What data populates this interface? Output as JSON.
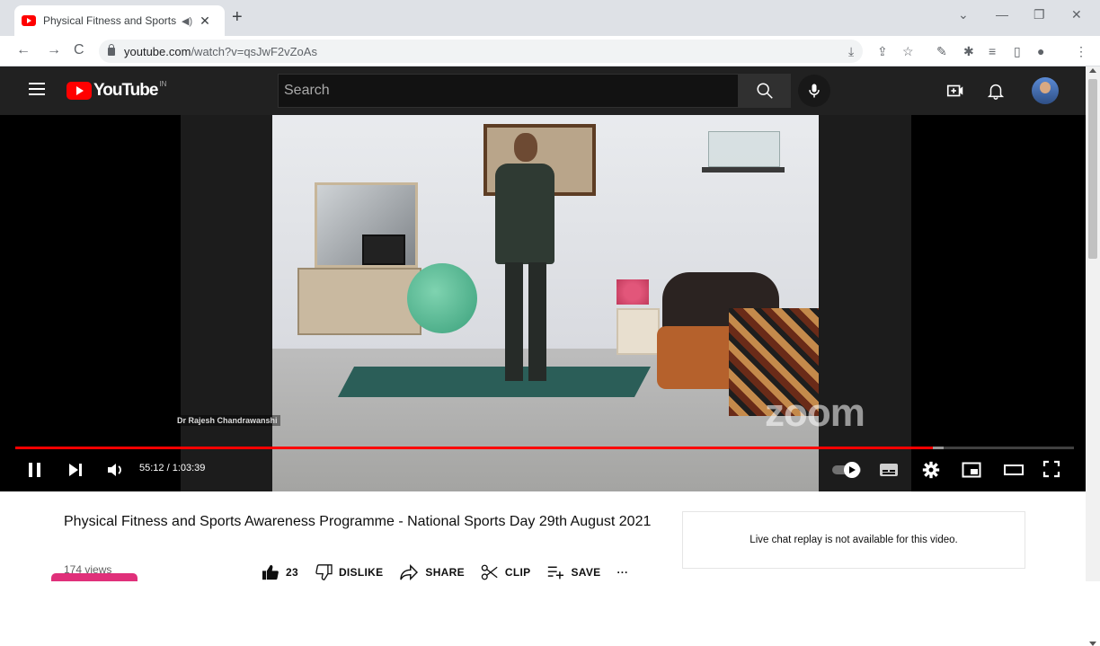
{
  "browser": {
    "tab_title": "Physical Fitness and Sports A",
    "tab_audio_icon": "speaker-icon",
    "url_domain": "youtube.com",
    "url_path": "/watch?v=qsJwF2vZoAs"
  },
  "youtube": {
    "logo_text": "YouTube",
    "logo_region": "IN",
    "search_placeholder": "Search"
  },
  "player": {
    "current_time": "55:12",
    "duration": "1:03:39",
    "time_display": "55:12 / 1:03:39",
    "played_fraction": 0.867,
    "loaded_fraction": 0.877,
    "overlay_caption": "Dr Rajesh Chandrawanshi",
    "watermark": "zoom"
  },
  "video": {
    "title": "Physical Fitness and Sports Awareness Programme - National Sports Day 29th August 2021",
    "views": "174 views",
    "likes": "23",
    "dislike_label": "DISLIKE",
    "share_label": "SHARE",
    "clip_label": "CLIP",
    "save_label": "SAVE",
    "more_label": "···"
  },
  "chat": {
    "message": "Live chat replay is not available for this video."
  },
  "colors": {
    "brand_red": "#ff0000",
    "header_bg": "#212121",
    "accent_pink": "#e0307a"
  }
}
